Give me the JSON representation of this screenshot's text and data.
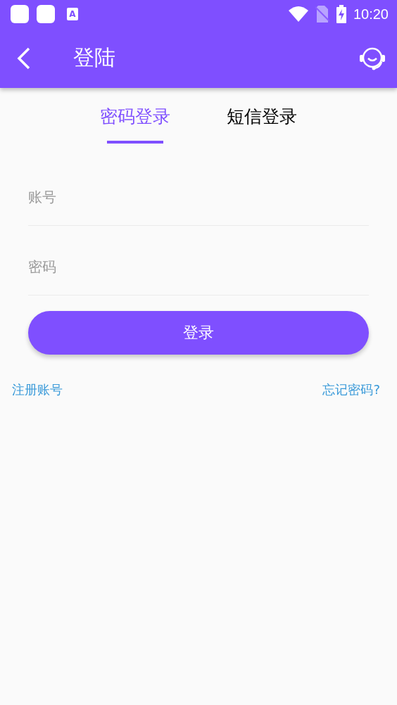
{
  "status_bar": {
    "keyboard_badge": "A",
    "time": "10:20"
  },
  "app_bar": {
    "title": "登陆"
  },
  "tabs": [
    {
      "label": "密码登录",
      "selected": true
    },
    {
      "label": "短信登录",
      "selected": false
    }
  ],
  "fields": [
    {
      "placeholder": "账号"
    },
    {
      "placeholder": "密码"
    }
  ],
  "login_button": "登录",
  "links": {
    "register": "注册账号",
    "forgot": "忘记密码?"
  }
}
